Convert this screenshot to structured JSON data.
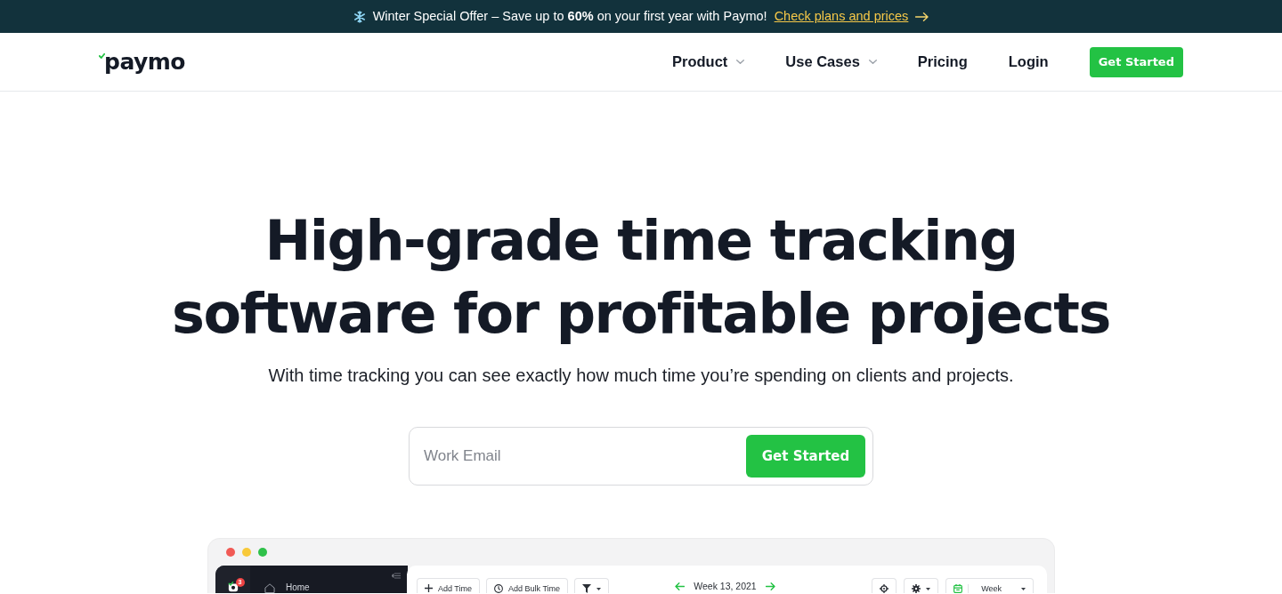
{
  "banner": {
    "text": "Winter Special Offer – Save up to **60%** on your first year with Paymo!",
    "link": "Check plans and prices"
  },
  "navbar": {
    "logo": "paymo",
    "items": [
      {
        "label": "Product",
        "dropdown": true
      },
      {
        "label": "Use Cases",
        "dropdown": true
      },
      {
        "label": "Pricing",
        "dropdown": false
      },
      {
        "label": "Login",
        "dropdown": false
      }
    ],
    "cta": "Get Started"
  },
  "hero": {
    "headline": "High-grade time tracking software for profitable projects",
    "subtitle": "With time tracking you can see exactly how much time you’re spending on clients and projects.",
    "signup": {
      "placeholder": "Work Email",
      "button": "Get Started"
    }
  },
  "app_preview": {
    "sidebar": {
      "badge": "3",
      "items": [
        {
          "label": "Home"
        }
      ]
    },
    "toolbar": {
      "left_buttons": [
        {
          "kind": "add",
          "label": "Add Time"
        },
        {
          "kind": "bulk",
          "label": "Add Bulk Time"
        },
        {
          "kind": "filter"
        }
      ],
      "period": "Week 13, 2021",
      "right_buttons": [
        {
          "kind": "locate"
        },
        {
          "kind": "settings"
        },
        {
          "kind": "view",
          "label": "Week"
        }
      ]
    }
  }
}
